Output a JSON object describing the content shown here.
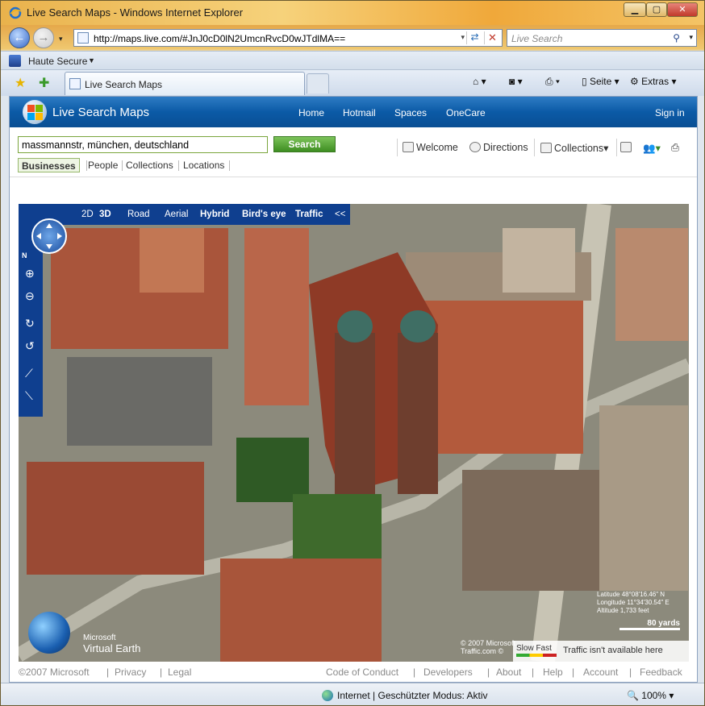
{
  "window": {
    "title": "Live Search Maps - Windows Internet Explorer"
  },
  "address": {
    "url": "http://maps.live.com/#JnJ0cD0lN2UmcnRvcD0wJTdlMA=="
  },
  "search_box": {
    "placeholder": "Live Search"
  },
  "linkbar": {
    "label": "Haute Secure"
  },
  "tab": {
    "title": "Live Search Maps"
  },
  "commands": {
    "page": "Seite",
    "tools": "Extras"
  },
  "site": {
    "name": "Live Search Maps",
    "nav": [
      "Home",
      "Hotmail",
      "Spaces",
      "OneCare"
    ],
    "signin": "Sign in"
  },
  "query": {
    "value": "massmannstr, münchen, deutschland",
    "button": "Search"
  },
  "search_tabs": [
    "Businesses",
    "People",
    "Collections",
    "Locations"
  ],
  "tools": {
    "welcome": "Welcome",
    "directions": "Directions",
    "collections": "Collections"
  },
  "map": {
    "modes": [
      "2D",
      "3D",
      "Road",
      "Aerial",
      "Hybrid",
      "Bird's eye",
      "Traffic",
      "<<"
    ],
    "north": "N",
    "brand_line1": "Microsoft",
    "brand_line2": "Virtual Earth",
    "latitude": "Latitude 48°08'16.46\" N",
    "longitude": "Longitude 11°34'30.54\" E",
    "altitude": "Altitude 1,733 feet",
    "scale": "80 yards",
    "copyright1": "© 2007 Microsoft",
    "copyright2": "Traffic.com ©",
    "traffic_legend": "Slow Fast",
    "traffic_msg": "Traffic isn't available here"
  },
  "footer": {
    "left": [
      "©2007 Microsoft",
      "Privacy",
      "Legal"
    ],
    "right": [
      "Code of Conduct",
      "Developers",
      "About",
      "Help",
      "Account",
      "Feedback"
    ]
  },
  "status": {
    "zone": "Internet | Geschützter Modus: Aktiv",
    "zoom": "100%"
  }
}
